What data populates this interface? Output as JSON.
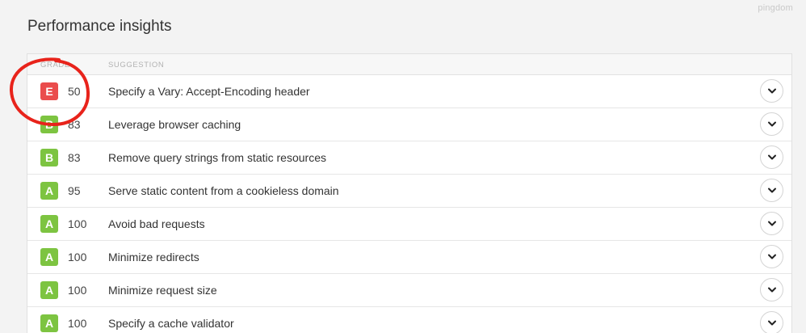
{
  "brand": "pingdom",
  "title": "Performance insights",
  "columns": {
    "grade": "GRADE",
    "suggestion": "SUGGESTION"
  },
  "colors": {
    "grade_A": "#7dc441",
    "grade_B": "#7dc441",
    "grade_E": "#ea4c4c",
    "annotation_circle": "#e8231b"
  },
  "rows": [
    {
      "grade": "E",
      "score": "50",
      "suggestion": "Specify a Vary: Accept-Encoding header",
      "expand_icon": "chevron-down-icon"
    },
    {
      "grade": "B",
      "score": "83",
      "suggestion": "Leverage browser caching",
      "expand_icon": "chevron-down-icon"
    },
    {
      "grade": "B",
      "score": "83",
      "suggestion": "Remove query strings from static resources",
      "expand_icon": "chevron-down-icon"
    },
    {
      "grade": "A",
      "score": "95",
      "suggestion": "Serve static content from a cookieless domain",
      "expand_icon": "chevron-down-icon"
    },
    {
      "grade": "A",
      "score": "100",
      "suggestion": "Avoid bad requests",
      "expand_icon": "chevron-down-icon"
    },
    {
      "grade": "A",
      "score": "100",
      "suggestion": "Minimize redirects",
      "expand_icon": "chevron-down-icon"
    },
    {
      "grade": "A",
      "score": "100",
      "suggestion": "Minimize request size",
      "expand_icon": "chevron-down-icon"
    },
    {
      "grade": "A",
      "score": "100",
      "suggestion": "Specify a cache validator",
      "expand_icon": "chevron-down-icon"
    }
  ]
}
